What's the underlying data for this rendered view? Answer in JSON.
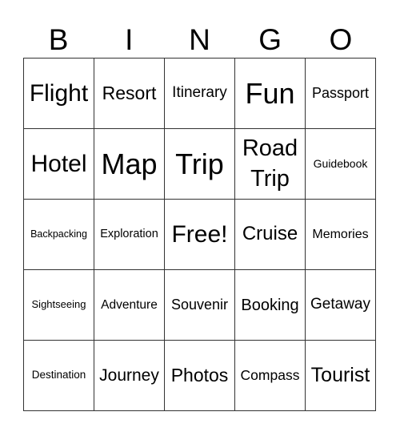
{
  "header": [
    "B",
    "I",
    "N",
    "G",
    "O"
  ],
  "cells": [
    [
      "Flight",
      "Resort",
      "Itinerary",
      "Fun",
      "Passport"
    ],
    [
      "Hotel",
      "Map",
      "Trip",
      "Road Trip",
      "Guidebook"
    ],
    [
      "Backpacking",
      "Exploration",
      "Free!",
      "Cruise",
      "Memories"
    ],
    [
      "Sightseeing",
      "Adventure",
      "Souvenir",
      "Booking",
      "Getaway"
    ],
    [
      "Destination",
      "Journey",
      "Photos",
      "Compass",
      "Tourist"
    ]
  ]
}
